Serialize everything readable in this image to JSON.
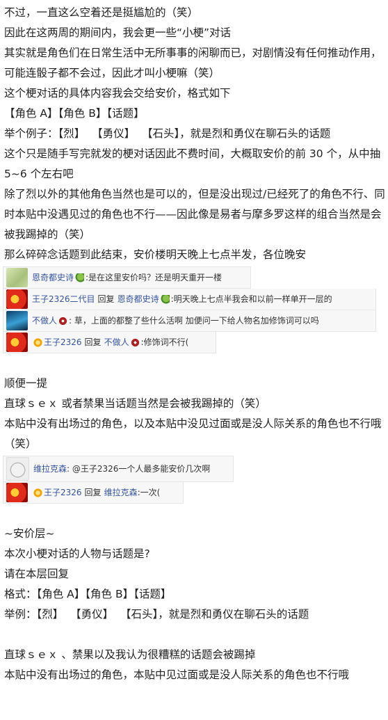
{
  "post": {
    "p1": "不过，一直这么空着还是挺尴尬的（笑）",
    "p2": "因此在这两周的期间内，我会更一些“小梗”对话",
    "p3": "其实就是角色们在日常生活中无所事事的闲聊而已，对剧情没有任何推动作用，可能连骰子都不会过，因此才叫小梗嘛（笑）",
    "p4": "这个梗对话的具体内容我会交给安价，格式如下",
    "p5": "【角色 A】【角色 B】【话题】",
    "p6": "举个例子：【烈】  【勇仪】  【石头】，就是烈和勇仪在聊石头的话题",
    "p7": "这个只是随手写完就发的梗对话因此不费时间，大概取安价的前 30 个，从中抽 5~6 个左右吧",
    "p8": "除了烈以外的其他角色当然也是可以的，但是没出现过/已经死了的角色不行、同时本贴中没遇见过的角色也不行——因此像是易者与摩多罗这样的组合当然是会被我踢掉的（笑）",
    "p9": "那么碎碎念话题到此结束，安价楼明天晚上七点半发，各位晚安",
    "p10": "顺便一提",
    "p11": "直球ｓｅｘ 或者禁果当话题当然是会被我踢掉的（笑）",
    "p12": "本贴中没有出场过的角色，以及本贴中没见过面或是没人际关系的角色也不行哦（笑）",
    "p13": "~安价层~",
    "p14": "本次小梗对话的人物与话题是?",
    "p15": "请在本层回复",
    "p16": "格式：【角色 A】【角色 B】【话题】",
    "p17": "举例：【烈】  【勇仪】  【石头】，就是烈和勇仪在聊石头的话题",
    "p18": "直球ｓｅｘ 、禁果以及我认为很糟糕的话题会被踢掉",
    "p19": "本贴中没有出场过的角色，本贴中见过面或是没人际关系的角色也不行哦"
  },
  "subreplies1": [
    {
      "user": "恩奇都史诗",
      "reply_word": "",
      "target": "",
      "text": ":是在这里安价吗？还是明天重开一楼"
    },
    {
      "user": "王子2326二代目",
      "reply_word": "回复",
      "target": "恩奇都史诗",
      "text": ":明天晚上七点半我会和以前一样单开一层的"
    },
    {
      "user": "不做人",
      "reply_word": "",
      "target": "",
      "text": ": 草，上面的都整了些什么活啊 加便问一下给人物名加修饰词可以吗"
    },
    {
      "user": "王子2326",
      "reply_word": "回复",
      "target": "不做人",
      "text": ":修饰词不行("
    }
  ],
  "subreplies2": [
    {
      "user": "维拉克森",
      "text": ": @王子2326一个人最多能安价几次啊"
    },
    {
      "user": "王子2326",
      "reply_word": "回复",
      "target": "维拉克森",
      "text": ":一次("
    }
  ],
  "icons": [
    "leaf-badge-icon",
    "x-badge-icon",
    "vip-badge-icon"
  ],
  "colors": {
    "username": "#3554a4",
    "text": "#222222",
    "subreply_bg": "#f7f7f7"
  }
}
